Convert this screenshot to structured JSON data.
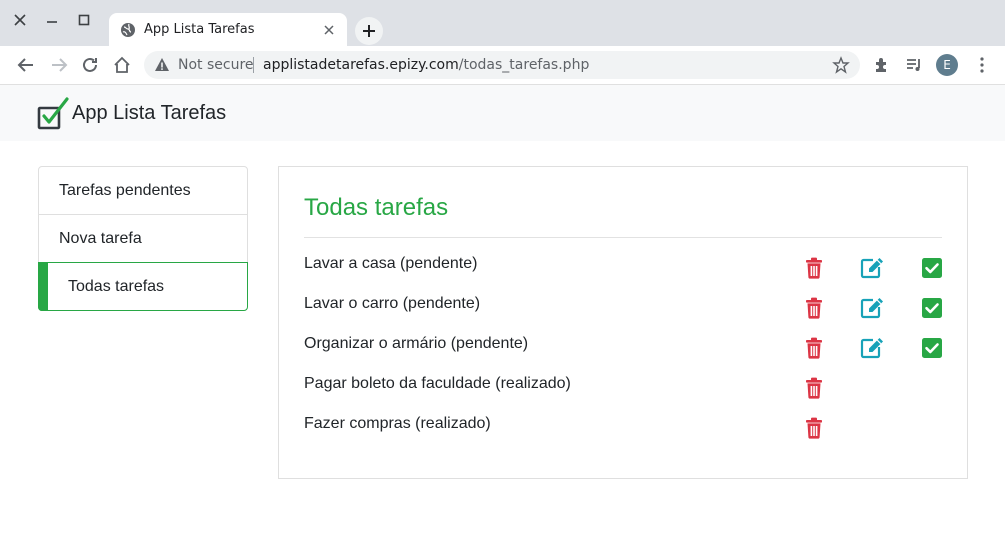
{
  "browser": {
    "tab_title": "App Lista Tarefas",
    "security_label": "Not secure",
    "url_host": "applistadetarefas.epizy.com",
    "url_path": "/todas_tarefas.php",
    "profile_initial": "E"
  },
  "app": {
    "brand": "App Lista Tarefas",
    "accent_color": "#28a745",
    "danger_color": "#dc3545",
    "info_color": "#17a2b8"
  },
  "sidebar": {
    "items": [
      {
        "label": "Tarefas pendentes",
        "active": false
      },
      {
        "label": "Nova tarefa",
        "active": false
      },
      {
        "label": "Todas tarefas",
        "active": true
      }
    ]
  },
  "main": {
    "title": "Todas tarefas",
    "tasks": [
      {
        "text": "Lavar a casa (pendente)",
        "status": "pendente",
        "actions": [
          "delete",
          "edit",
          "complete"
        ]
      },
      {
        "text": "Lavar o carro (pendente)",
        "status": "pendente",
        "actions": [
          "delete",
          "edit",
          "complete"
        ]
      },
      {
        "text": "Organizar o armário (pendente)",
        "status": "pendente",
        "actions": [
          "delete",
          "edit",
          "complete"
        ]
      },
      {
        "text": "Pagar boleto da faculdade (realizado)",
        "status": "realizado",
        "actions": [
          "delete"
        ]
      },
      {
        "text": "Fazer compras (realizado)",
        "status": "realizado",
        "actions": [
          "delete"
        ]
      }
    ],
    "icons": {
      "delete": "trash-icon",
      "edit": "edit-icon",
      "complete": "check-square-icon"
    }
  }
}
